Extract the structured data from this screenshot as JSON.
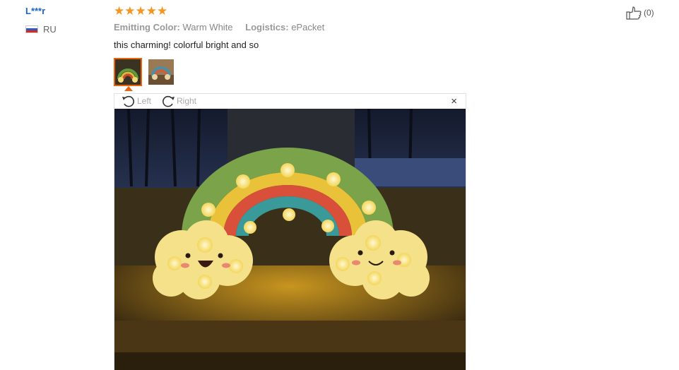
{
  "reviewer": {
    "name": "L***r",
    "country": "RU"
  },
  "rating": {
    "stars": 5,
    "max": 5
  },
  "attributes": [
    {
      "label": "Emitting Color:",
      "value": "Warm White"
    },
    {
      "label": "Logistics:",
      "value": "ePacket"
    }
  ],
  "review_text": "this charming! colorful bright and so",
  "thumbnails": [
    {
      "selected": true
    },
    {
      "selected": false
    }
  ],
  "viewer": {
    "rotate_left": "Left",
    "rotate_right": "Right",
    "close": "×"
  },
  "like": {
    "count": "(0)"
  },
  "colors": {
    "accent": "#e8630a",
    "star": "#f7941d",
    "link": "#1a66c4"
  },
  "icons": [
    "russia-flag-icon",
    "star-icon",
    "rotate-left-icon",
    "rotate-right-icon",
    "close-icon",
    "thumbs-up-icon"
  ]
}
